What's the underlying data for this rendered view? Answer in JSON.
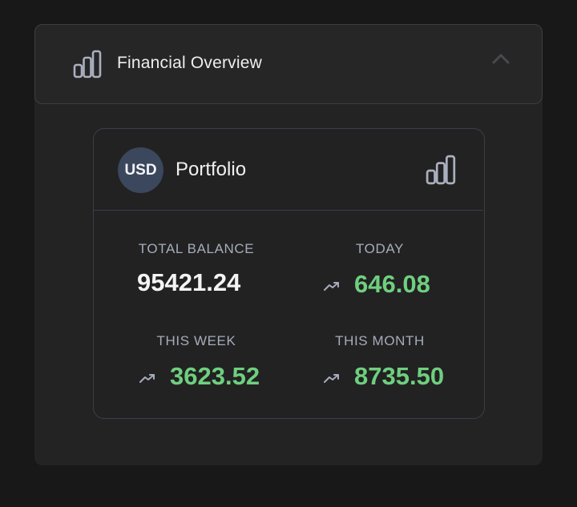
{
  "header": {
    "title": "Financial Overview",
    "icon": "bar-chart-icon",
    "toggle_icon": "chevron-up-icon"
  },
  "card": {
    "currency_badge": "USD",
    "title": "Portfolio",
    "icon": "bar-chart-icon"
  },
  "stats": {
    "total_balance": {
      "label": "TOTAL BALANCE",
      "value": "95421.24"
    },
    "today": {
      "label": "TODAY",
      "value": "646.08",
      "trend_icon": "trending-up-icon"
    },
    "this_week": {
      "label": "THIS WEEK",
      "value": "3623.52",
      "trend_icon": "trending-up-icon"
    },
    "this_month": {
      "label": "THIS MONTH",
      "value": "8735.50",
      "trend_icon": "trending-up-icon"
    }
  },
  "colors": {
    "background": "#181818",
    "panel": "#232323",
    "positive": "#6fcf7f",
    "muted_text": "#a6acbb",
    "badge": "#3b475c"
  }
}
